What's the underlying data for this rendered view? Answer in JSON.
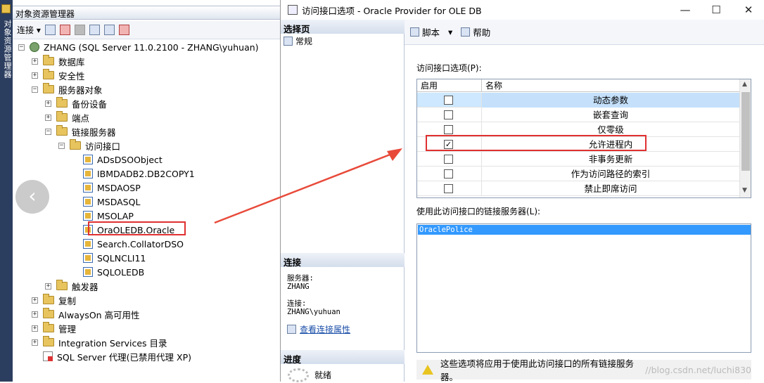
{
  "left_strip": {
    "label": "对象资源管理器"
  },
  "object_explorer": {
    "title": "对象资源管理器",
    "toolbar": {
      "connect_label": "连接"
    },
    "tree": [
      {
        "label": "ZHANG (SQL Server 11.0.2100 - ZHANG\\yuhuan)",
        "kind": "server",
        "expander": "⊟"
      },
      {
        "label": "数据库",
        "kind": "folder",
        "expander": "+"
      },
      {
        "label": "安全性",
        "kind": "folder",
        "expander": "+"
      },
      {
        "label": "服务器对象",
        "kind": "folder",
        "expander": "−"
      },
      {
        "label": "备份设备",
        "kind": "folder",
        "expander": "+"
      },
      {
        "label": "端点",
        "kind": "folder",
        "expander": "+"
      },
      {
        "label": "链接服务器",
        "kind": "folder",
        "expander": "−"
      },
      {
        "label": "访问接口",
        "kind": "folder",
        "expander": "−"
      },
      {
        "label": "ADsDSOObject",
        "kind": "provider"
      },
      {
        "label": "IBMDADB2.DB2COPY1",
        "kind": "provider"
      },
      {
        "label": "MSDAOSP",
        "kind": "provider"
      },
      {
        "label": "MSDASQL",
        "kind": "provider"
      },
      {
        "label": "MSOLAP",
        "kind": "provider"
      },
      {
        "label": "OraOLEDB.Oracle",
        "kind": "provider",
        "highlighted": true
      },
      {
        "label": "Search.CollatorDSO",
        "kind": "provider"
      },
      {
        "label": "SQLNCLI11",
        "kind": "provider"
      },
      {
        "label": "SQLOLEDB",
        "kind": "provider"
      },
      {
        "label": "触发器",
        "kind": "folder",
        "expander": "+"
      },
      {
        "label": "复制",
        "kind": "folder",
        "expander": "+"
      },
      {
        "label": "AlwaysOn 高可用性",
        "kind": "folder",
        "expander": "+"
      },
      {
        "label": "管理",
        "kind": "folder",
        "expander": "+"
      },
      {
        "label": "Integration Services 目录",
        "kind": "folder",
        "expander": "+"
      },
      {
        "label": "SQL Server 代理(已禁用代理 XP)",
        "kind": "agent"
      }
    ]
  },
  "dialog": {
    "title": "访问接口选项 - Oracle Provider for OLE DB",
    "window_buttons": {
      "minimize": "—",
      "maximize": "☐",
      "close": "✕"
    },
    "sidebar": {
      "select_page_header": "选择页",
      "pages": [
        "常规"
      ],
      "connection_header": "连接",
      "server_label": "服务器:",
      "server_value": "ZHANG",
      "connection_label": "连接:",
      "connection_value": "ZHANG\\yuhuan",
      "view_connection_link": "查看连接属性",
      "progress_header": "进度",
      "progress_status": "就绪"
    },
    "toolbar": {
      "script_label": "脚本",
      "help_label": "帮助"
    },
    "options_label": "访问接口选项(P):",
    "grid": {
      "headers": [
        "启用",
        "名称"
      ],
      "rows": [
        {
          "enabled": false,
          "name": "动态参数",
          "selected": true
        },
        {
          "enabled": false,
          "name": "嵌套查询"
        },
        {
          "enabled": false,
          "name": "仅零级"
        },
        {
          "enabled": true,
          "name": "允许进程内",
          "highlighted": true
        },
        {
          "enabled": false,
          "name": "非事务更新"
        },
        {
          "enabled": false,
          "name": "作为访问路径的索引"
        },
        {
          "enabled": false,
          "name": "禁止即席访问"
        }
      ]
    },
    "linked_servers_label": "使用此访问接口的链接服务器(L):",
    "linked_servers": [
      "OraclePolice"
    ],
    "note": "这些选项将应用于使用此访问接口的所有链接服务器。",
    "watermark": "//blog.csdn.net/luchi830"
  },
  "colors": {
    "highlight_red": "#e03030",
    "selection_blue": "#3399ff",
    "grid_selected": "#cde8ff"
  }
}
